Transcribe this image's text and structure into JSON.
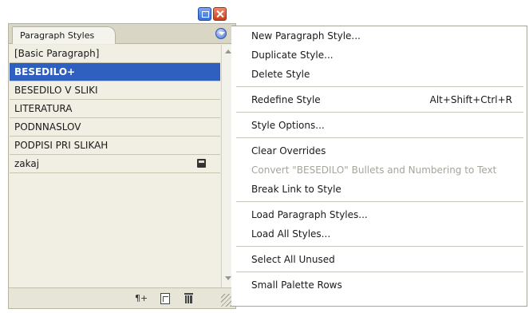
{
  "panel": {
    "tab_label": "Paragraph Styles",
    "styles": [
      {
        "label": "[Basic Paragraph]",
        "selected": false,
        "icon": null
      },
      {
        "label": "BESEDILO+",
        "selected": true,
        "icon": null
      },
      {
        "label": "BESEDILO V SLIKI",
        "selected": false,
        "icon": null
      },
      {
        "label": "LITERATURA",
        "selected": false,
        "icon": null
      },
      {
        "label": "PODNNASLOV",
        "selected": false,
        "icon": null
      },
      {
        "label": "PODPISI PRI SLIKAH",
        "selected": false,
        "icon": null
      },
      {
        "label": "zakaj",
        "selected": false,
        "icon": "style-group-icon"
      }
    ],
    "bottom_icons": [
      "clear-overrides-icon",
      "new-style-icon",
      "trash-icon"
    ],
    "clear_overrides_glyph": "¶+"
  },
  "menu": {
    "groups": [
      [
        {
          "label": "New Paragraph Style...",
          "disabled": false
        },
        {
          "label": "Duplicate Style...",
          "disabled": false
        },
        {
          "label": "Delete Style",
          "disabled": false
        }
      ],
      [
        {
          "label": "Redefine Style",
          "shortcut": "Alt+Shift+Ctrl+R",
          "disabled": false
        }
      ],
      [
        {
          "label": "Style Options...",
          "disabled": false
        }
      ],
      [
        {
          "label": "Clear Overrides",
          "disabled": false
        },
        {
          "label": "Convert \"BESEDILO\" Bullets and Numbering to Text",
          "disabled": true
        },
        {
          "label": "Break Link to Style",
          "disabled": false
        }
      ],
      [
        {
          "label": "Load Paragraph Styles...",
          "disabled": false
        },
        {
          "label": "Load All Styles...",
          "disabled": false
        }
      ],
      [
        {
          "label": "Select All Unused",
          "disabled": false
        }
      ],
      [
        {
          "label": "Small Palette Rows",
          "disabled": false
        }
      ]
    ]
  },
  "colors": {
    "selection": "#2f5fbf",
    "panel_bg": "#eceadf",
    "disabled_text": "#a6a49b"
  }
}
